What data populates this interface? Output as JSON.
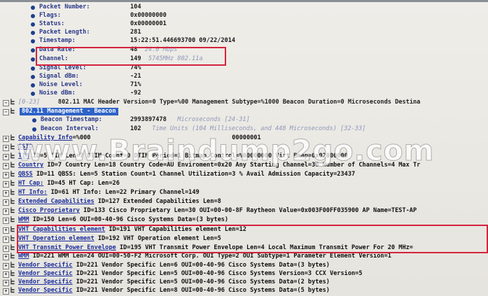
{
  "fields": [
    {
      "label": "Packet Number:",
      "value": "104"
    },
    {
      "label": "Flags:",
      "value": "0x00000000"
    },
    {
      "label": "Status:",
      "value": "0x00000001"
    },
    {
      "label": "Packet Length:",
      "value": "281"
    },
    {
      "label": "Timestamp:",
      "value": "15:22:51.446693700 09/22/2014"
    },
    {
      "label": "Data Rate:",
      "value": "48",
      "detail": "24.0 Mbps"
    },
    {
      "label": "Channel:",
      "value": "149",
      "detail": "5745MHz  802.11a"
    },
    {
      "label": "Signal Level:",
      "value": "74%"
    },
    {
      "label": "Signal dBm:",
      "value": "-21"
    },
    {
      "label": "Noise Level:",
      "value": "71%"
    },
    {
      "label": "Noise dBm:",
      "value": "-92"
    }
  ],
  "mac_header": {
    "range": "[0-23]",
    "text": "802.11 MAC Header",
    "rest": "Version=0 Type=%00 Management Subtype=%1000 Beacon Duration=0 Microseconds Destina"
  },
  "mgmt": {
    "label": "802.11 Management - Beacon"
  },
  "beacon_fields": [
    {
      "label": "Beacon Timestamp:",
      "value": "2993897478",
      "detail": "Microseconds [24-31]"
    },
    {
      "label": "Beacon Interval:",
      "value": "102",
      "detail": "Time Units (104 Milliseconds, and 448 Microseconds) [32-33]"
    }
  ],
  "elements": [
    {
      "name": "Capability Info",
      "rest": "=%000                                       00000001"
    },
    {
      "name": "SSID",
      "rest": ""
    },
    {
      "name": "TIM",
      "rest": " ID=5 TIM Len=7 DTIM Count=0 DTIM Period=1 Bitmap Control=%00000000 Virt Bmap=0x02000000"
    },
    {
      "name": "Country",
      "rest": " ID=7 Country Len=18 Country Code=AU Enviroment=0x20 Any Starting Channel=36 Number of Channels=4 Max Tr"
    },
    {
      "name": "QBSS",
      "rest": " ID=11 QBSS: Len=5 Station Count=1 Channel Utilization=3 % Avail Admission Capacity=23437"
    },
    {
      "name": "HT Cap:",
      "rest": " ID=45 HT Cap: Len=26"
    },
    {
      "name": "HT Info:",
      "rest": " ID=61 HT Info: Len=22 Primary Channel=149"
    },
    {
      "name": "Extended Capabilities",
      "rest": " ID=127 Extended Capabilities Len=8"
    },
    {
      "name": "Cisco Proprietary",
      "rest": " ID=133 Cisco Proprietary Len=30 OUI=00-00-8F Raytheon Value=0x003F00FF035900 AP Name=TEST-AP"
    },
    {
      "name": "WMM",
      "rest": " ID=150 Len=6 OUI=00-40-96 Cisco Systems Data=(3 bytes)"
    },
    {
      "name": "VHT Capabilities element",
      "rest": " ID=191 VHT Capabilities element Len=12"
    },
    {
      "name": "VHT Operation element",
      "rest": " ID=192 VHT Operation element Len=5"
    },
    {
      "name": "VHT Transmit Power Envelope",
      "rest": " ID=195 VHT Transmit Power Envelope Len=4 Local Maximum Transmit Power For 20 MHz="
    },
    {
      "name": "WMM",
      "rest": " ID=221 WMM Len=24 OUI=00-50-F2 Microsoft Corp. OUI Type=2 OUI Subtype=1 Parameter Element Version=1"
    },
    {
      "name": "Vendor Specific",
      "rest": " ID=221 Vendor Specific Len=6 OUI=00-40-96 Cisco Systems Data=(3 bytes)"
    },
    {
      "name": "Vendor Specific",
      "rest": " ID=221 Vendor Specific Len=5 OUI=00-40-96 Cisco Systems Version=3 CCX Version=5"
    },
    {
      "name": "Vendor Specific",
      "rest": " ID=221 Vendor Specific Len=5 OUI=00-40-96 Cisco Systems Data=(2 bytes)"
    },
    {
      "name": "Vendor Specific",
      "rest": " ID=221 Vendor Specific Len=8 OUI=00-40-96 Cisco Systems Data=(5 bytes)"
    }
  ],
  "watermark": "www.Braindump2go.com",
  "colors": {
    "highlight_box": "#d4233c",
    "selection": "#2e63c8",
    "link": "#1c2f9c",
    "bullet": "#1e3f8f"
  }
}
